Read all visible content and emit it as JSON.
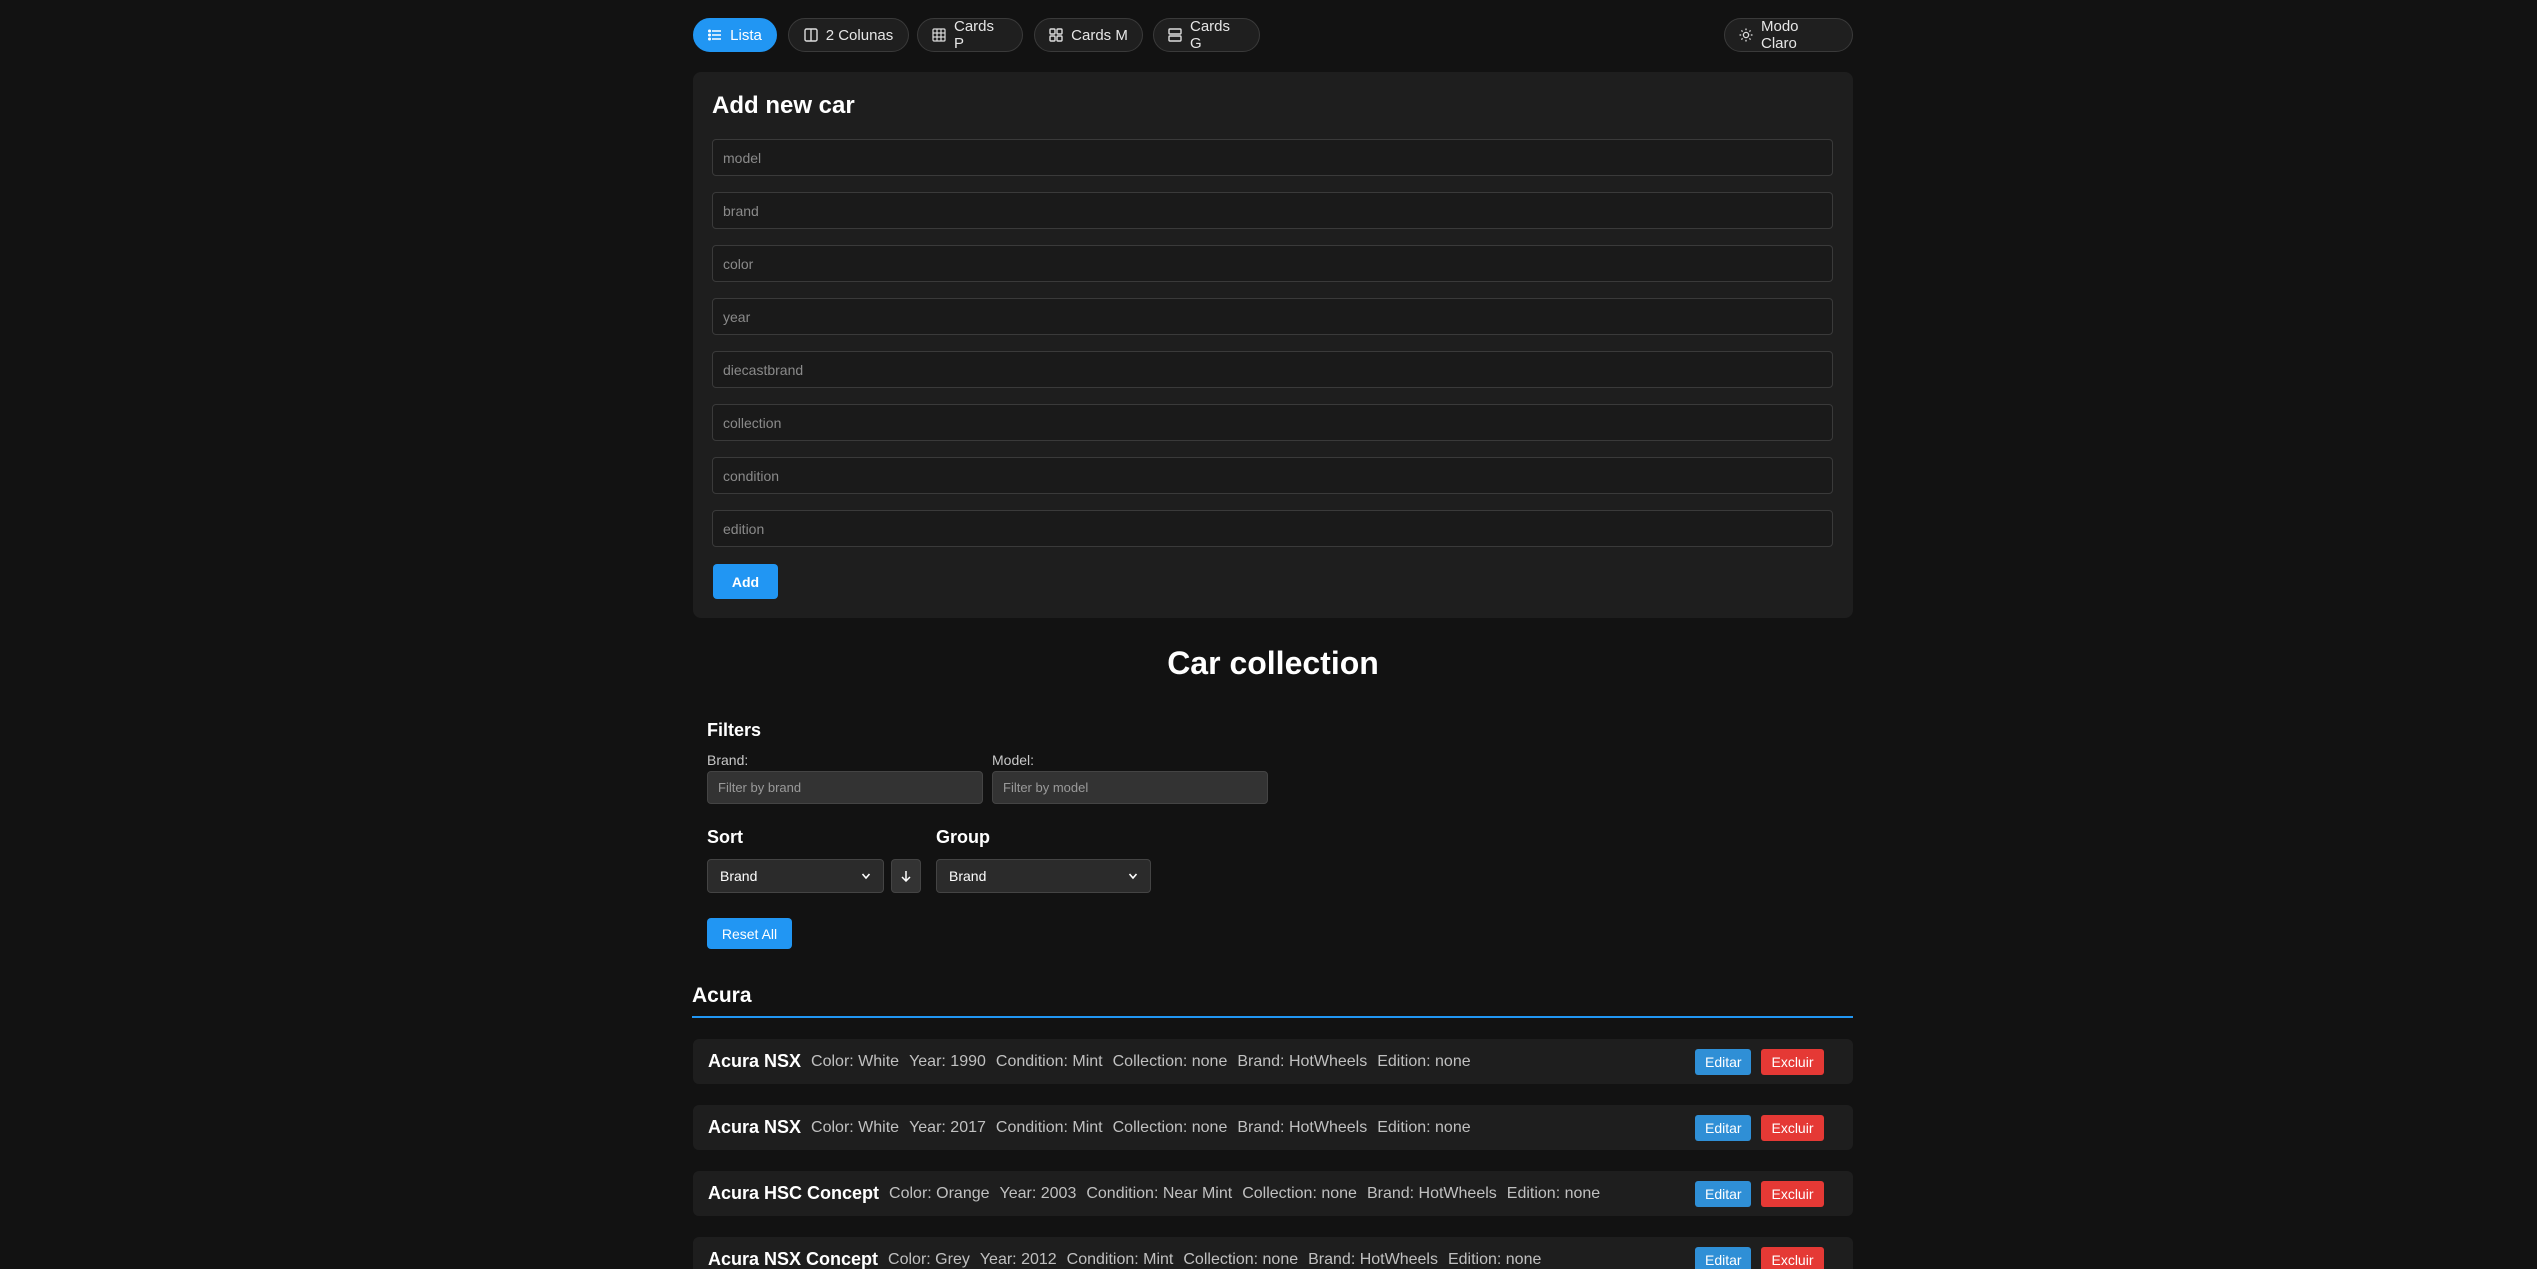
{
  "toolbar": {
    "views": [
      {
        "label": "Lista",
        "icon": "list-icon",
        "active": true
      },
      {
        "label": "2 Colunas",
        "icon": "columns-icon",
        "active": false
      },
      {
        "label": "Cards P",
        "icon": "grid-small-icon",
        "active": false
      },
      {
        "label": "Cards M",
        "icon": "grid-medium-icon",
        "active": false
      },
      {
        "label": "Cards G",
        "icon": "grid-large-icon",
        "active": false
      }
    ],
    "theme_label": "Modo Claro",
    "theme_icon": "sun-icon"
  },
  "add_form": {
    "title": "Add new car",
    "placeholders": {
      "model": "model",
      "brand": "brand",
      "color": "color",
      "year": "year",
      "diecastbrand": "diecastbrand",
      "collection": "collection",
      "condition": "condition",
      "edition": "edition"
    },
    "add_label": "Add"
  },
  "collection": {
    "title": "Car collection",
    "filters": {
      "title": "Filters",
      "brand_label": "Brand:",
      "brand_placeholder": "Filter by brand",
      "model_label": "Model:",
      "model_placeholder": "Filter by model"
    },
    "sort": {
      "title": "Sort",
      "value": "Brand",
      "direction_icon": "arrow-down-icon"
    },
    "group": {
      "title": "Group",
      "value": "Brand"
    },
    "reset_label": "Reset All"
  },
  "groups": [
    {
      "name": "Acura",
      "cars": [
        {
          "model": "Acura NSX",
          "color": "Color: White",
          "year": "Year: 1990",
          "condition": "Condition: Mint",
          "collection": "Collection: none",
          "brand": "Brand: HotWheels",
          "edition": "Edition: none"
        },
        {
          "model": "Acura NSX",
          "color": "Color: White",
          "year": "Year: 2017",
          "condition": "Condition: Mint",
          "collection": "Collection: none",
          "brand": "Brand: HotWheels",
          "edition": "Edition: none"
        },
        {
          "model": "Acura HSC Concept",
          "color": "Color: Orange",
          "year": "Year: 2003",
          "condition": "Condition: Near Mint",
          "collection": "Collection: none",
          "brand": "Brand: HotWheels",
          "edition": "Edition: none"
        },
        {
          "model": "Acura NSX Concept",
          "color": "Color: Grey",
          "year": "Year: 2012",
          "condition": "Condition: Mint",
          "collection": "Collection: none",
          "brand": "Brand: HotWheels",
          "edition": "Edition: none"
        }
      ]
    }
  ],
  "row_actions": {
    "edit_label": "Editar",
    "delete_label": "Excluir"
  },
  "colors": {
    "accent": "#2196f3",
    "danger": "#e53935",
    "background": "#121212",
    "surface": "#1e1e1e"
  }
}
